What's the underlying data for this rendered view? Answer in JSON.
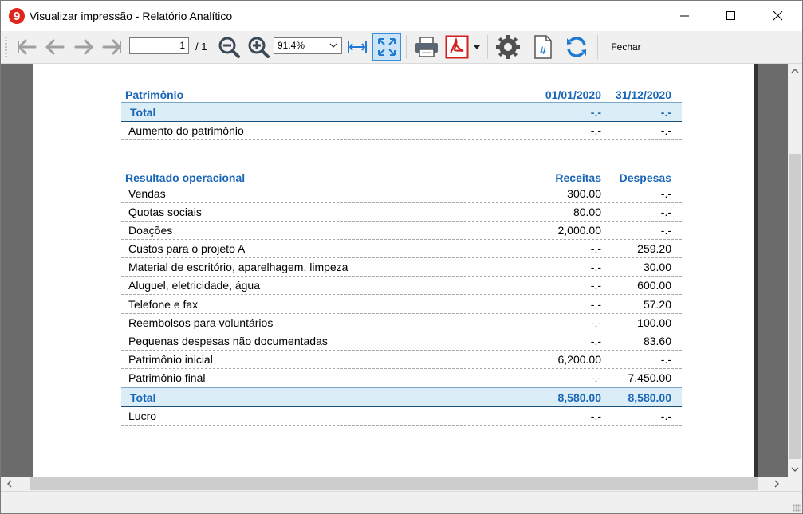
{
  "window": {
    "title": "Visualizar impressão - Relatório Analítico"
  },
  "toolbar": {
    "page_value": "1",
    "page_total": "/ 1",
    "zoom_value": "91.4%",
    "close_label": "Fechar"
  },
  "report": {
    "patrimonio": {
      "header": {
        "label": "Patrimônio",
        "col1": "01/01/2020",
        "col2": "31/12/2020"
      },
      "total": {
        "label": "Total",
        "col1": "-.-",
        "col2": "-.-"
      },
      "rows": [
        {
          "label": "Aumento do patrimônio",
          "col1": "-.-",
          "col2": "-.-"
        }
      ]
    },
    "resultado": {
      "header": {
        "label": "Resultado operacional",
        "col1": "Receitas",
        "col2": "Despesas"
      },
      "rows": [
        {
          "label": "Vendas",
          "col1": "300.00",
          "col2": "-.-"
        },
        {
          "label": "Quotas sociais",
          "col1": "80.00",
          "col2": "-.-"
        },
        {
          "label": "Doações",
          "col1": "2,000.00",
          "col2": "-.-"
        },
        {
          "label": "Custos para o projeto A",
          "col1": "-.-",
          "col2": "259.20"
        },
        {
          "label": "Material de escritório, aparelhagem, limpeza",
          "col1": "-.-",
          "col2": "30.00"
        },
        {
          "label": "Aluguel, eletricidade, água",
          "col1": "-.-",
          "col2": "600.00"
        },
        {
          "label": "Telefone e fax",
          "col1": "-.-",
          "col2": "57.20"
        },
        {
          "label": "Reembolsos para voluntários",
          "col1": "-.-",
          "col2": "100.00"
        },
        {
          "label": "Pequenas despesas não documentadas",
          "col1": "-.-",
          "col2": "83.60"
        },
        {
          "label": "Patrimônio inicial",
          "col1": "6,200.00",
          "col2": "-.-"
        },
        {
          "label": "Patrimônio final",
          "col1": "-.-",
          "col2": "7,450.00"
        }
      ],
      "total": {
        "label": "Total",
        "col1": "8,580.00",
        "col2": "8,580.00"
      },
      "result": {
        "label": "Lucro",
        "col1": "-.-",
        "col2": "-.-"
      }
    }
  },
  "colors": {
    "accent": "#1a66b8",
    "total_bg": "#dbeef7",
    "pdf_red": "#d11f1f",
    "refresh_blue": "#1f7bd1"
  }
}
